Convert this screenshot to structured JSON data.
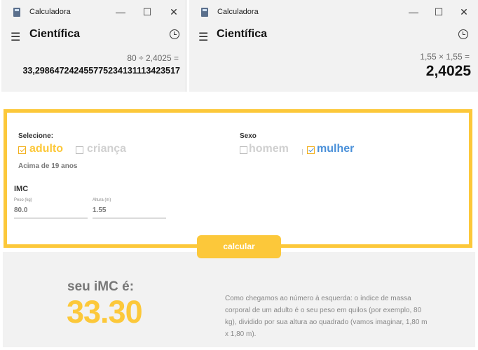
{
  "calc_windows": [
    {
      "title": "Calculadora",
      "mode": "Científica",
      "expression": "80 ÷ 2,4025 =",
      "result": "33,2986472424557752341311134235 17"
    },
    {
      "title": "Calculadora",
      "mode": "Científica",
      "expression": "1,55 × 1,55 =",
      "result": "2,4025"
    }
  ],
  "bmi": {
    "select_label": "Selecione:",
    "age_options": [
      {
        "label": "adulto",
        "checked": true
      },
      {
        "label": "criança",
        "checked": false
      }
    ],
    "age_note": "Acima de 19 anos",
    "sex_label": "Sexo",
    "sex_options": [
      {
        "label": "homem",
        "checked": false
      },
      {
        "label": "mulher",
        "checked": true
      }
    ],
    "imc_label": "IMC",
    "weight_label": "Peso (kg)",
    "weight_value": "80.0",
    "height_label": "Altura (m)",
    "height_value": "1.55",
    "calculate_button": "calcular",
    "result_heading": "seu iMC é:",
    "result_value": "33.30",
    "explanation": "Como chegamos ao número à esquerda: o índice de massa corporal de um adulto é o seu peso em quilos (por exemplo, 80 kg), dividido por sua altura ao quadrado (vamos imaginar, 1,80 m x 1,80 m)."
  },
  "colors": {
    "accent": "#fcc83a",
    "selected_sex": "#4a90d9",
    "disabled": "#cccccc"
  },
  "icons": [
    "calculator-app-icon",
    "minimize-icon",
    "maximize-icon",
    "close-icon",
    "menu-icon",
    "history-icon",
    "checkbox-icon"
  ]
}
